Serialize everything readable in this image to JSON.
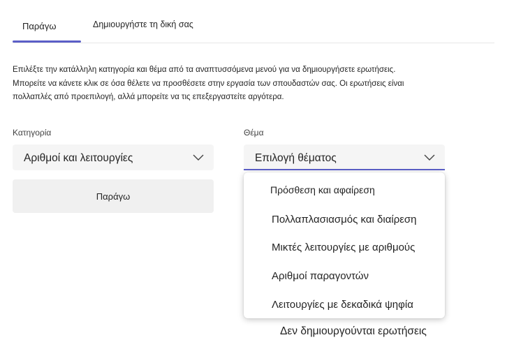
{
  "tabs": [
    {
      "label": "Παράγω",
      "active": true
    },
    {
      "label": "Δημιουργήστε τη δική σας",
      "active": false
    }
  ],
  "instructions": [
    "Επιλέξτε την κατάλληλη κατηγορία και θέμα από τα αναπτυσσόμενα μενού για να δημιουργήσετε ερωτήσεις.",
    "Μπορείτε να κάνετε κλικ σε όσα θέλετε να προσθέσετε στην εργασία των σπουδαστών σας. Οι ερωτήσεις είναι",
    "πολλαπλές από προεπιλογή, αλλά μπορείτε να τις επεξεργαστείτε αργότερα."
  ],
  "category": {
    "label": "Κατηγορία",
    "value": "Αριθμοί και λειτουργίες"
  },
  "topic": {
    "label": "Θέμα",
    "value": "Επιλογή θέματος",
    "options": [
      "Πρόσθεση και αφαίρεση",
      "Πολλαπλασιασμός και διαίρεση",
      "Μικτές λειτουργίες με αριθμούς",
      "Αριθμοί παραγοντών",
      "Λειτουργίες με δεκαδικά ψηφία"
    ]
  },
  "generate_button": "Παράγω",
  "empty_state": "Δεν δημιουργούνται ερωτήσεις",
  "colors": {
    "accent": "#5b5fc7",
    "field_bg": "#f5f5f5"
  }
}
